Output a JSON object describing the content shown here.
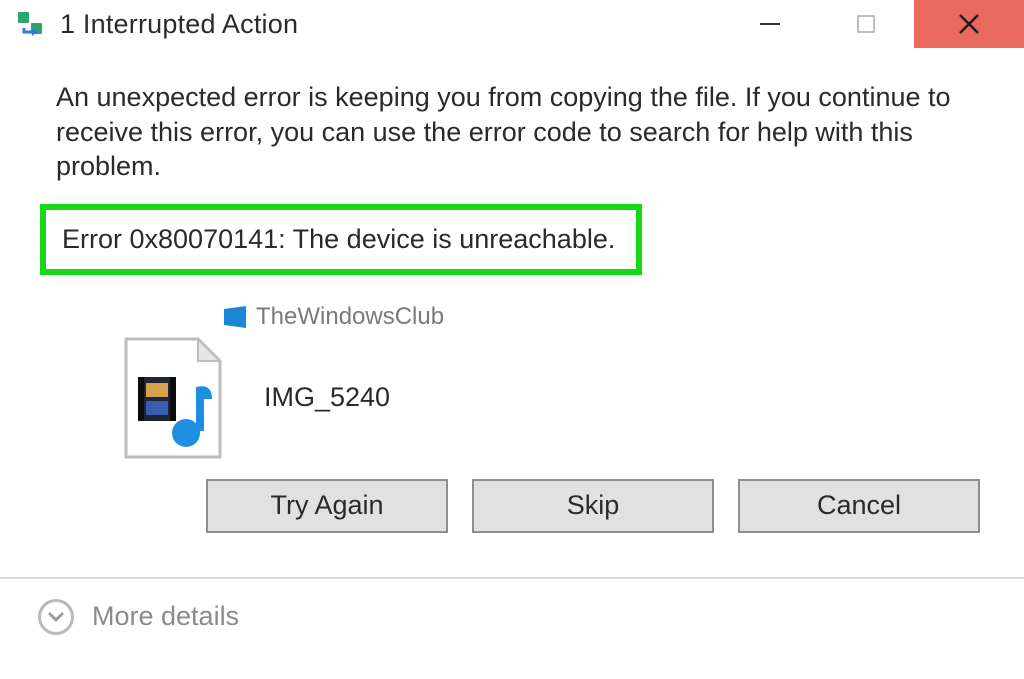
{
  "title": "1 Interrupted Action",
  "message": "An unexpected error is keeping you from copying the file. If you continue to receive this error, you can use the error code to search for help with this problem.",
  "error": "Error 0x80070141: The device is unreachable.",
  "watermark_label": "TheWindowsClub",
  "file": {
    "name": "IMG_5240"
  },
  "buttons": {
    "try_again": "Try Again",
    "skip": "Skip",
    "cancel": "Cancel"
  },
  "more_details": "More details",
  "colors": {
    "highlight_border": "#17d817",
    "close_btn": "#e9695e"
  }
}
